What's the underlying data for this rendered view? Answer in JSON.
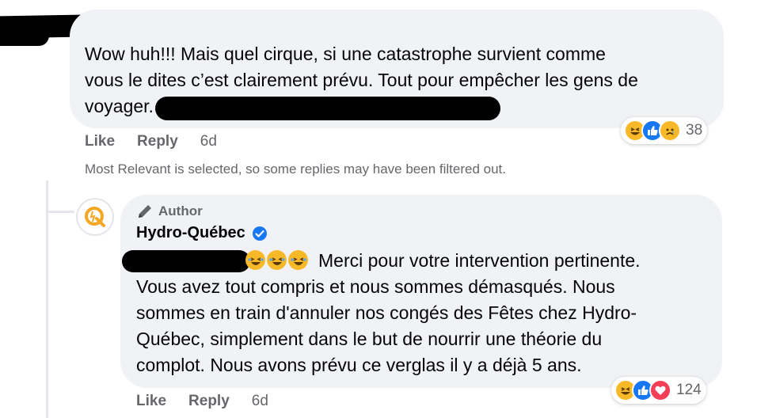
{
  "comment1": {
    "lines": [
      "Wow huh!!! Mais quel cirque, si une catastrophe survient comme",
      "vous le dites c’est clairement prévu. Tout pour empêcher les gens de",
      "voyager."
    ],
    "actions": {
      "like": "Like",
      "reply": "Reply",
      "time": "6d"
    },
    "reactions": {
      "icons": [
        "haha-icon",
        "like-icon",
        "sad-icon"
      ],
      "count": "38"
    }
  },
  "filter_notice": "Most Relevant is selected, so some replies may have been filtered out.",
  "reply": {
    "author_badge": "Author",
    "name": "Hydro-Québec",
    "verified": true,
    "lines": [
      "Merci pour votre intervention pertinente.",
      "Vous avez tout compris et nous sommes démasqués. Nous",
      "sommes en train d'annuler nos congés des Fêtes chez Hydro-",
      "Québec, simplement dans le but de nourrir une théorie du",
      "complot. Nous avons prévu ce verglas il y a déjà 5 ans."
    ],
    "actions": {
      "like": "Like",
      "reply": "Reply",
      "time": "6d"
    },
    "reactions": {
      "icons": [
        "haha-icon",
        "like-icon",
        "love-icon"
      ],
      "count": "124"
    }
  },
  "colors": {
    "bubble": "#f0f2f5",
    "secondary_text": "#65676b",
    "verified_blue": "#1877f2",
    "hydro_orange": "#f5a623"
  }
}
